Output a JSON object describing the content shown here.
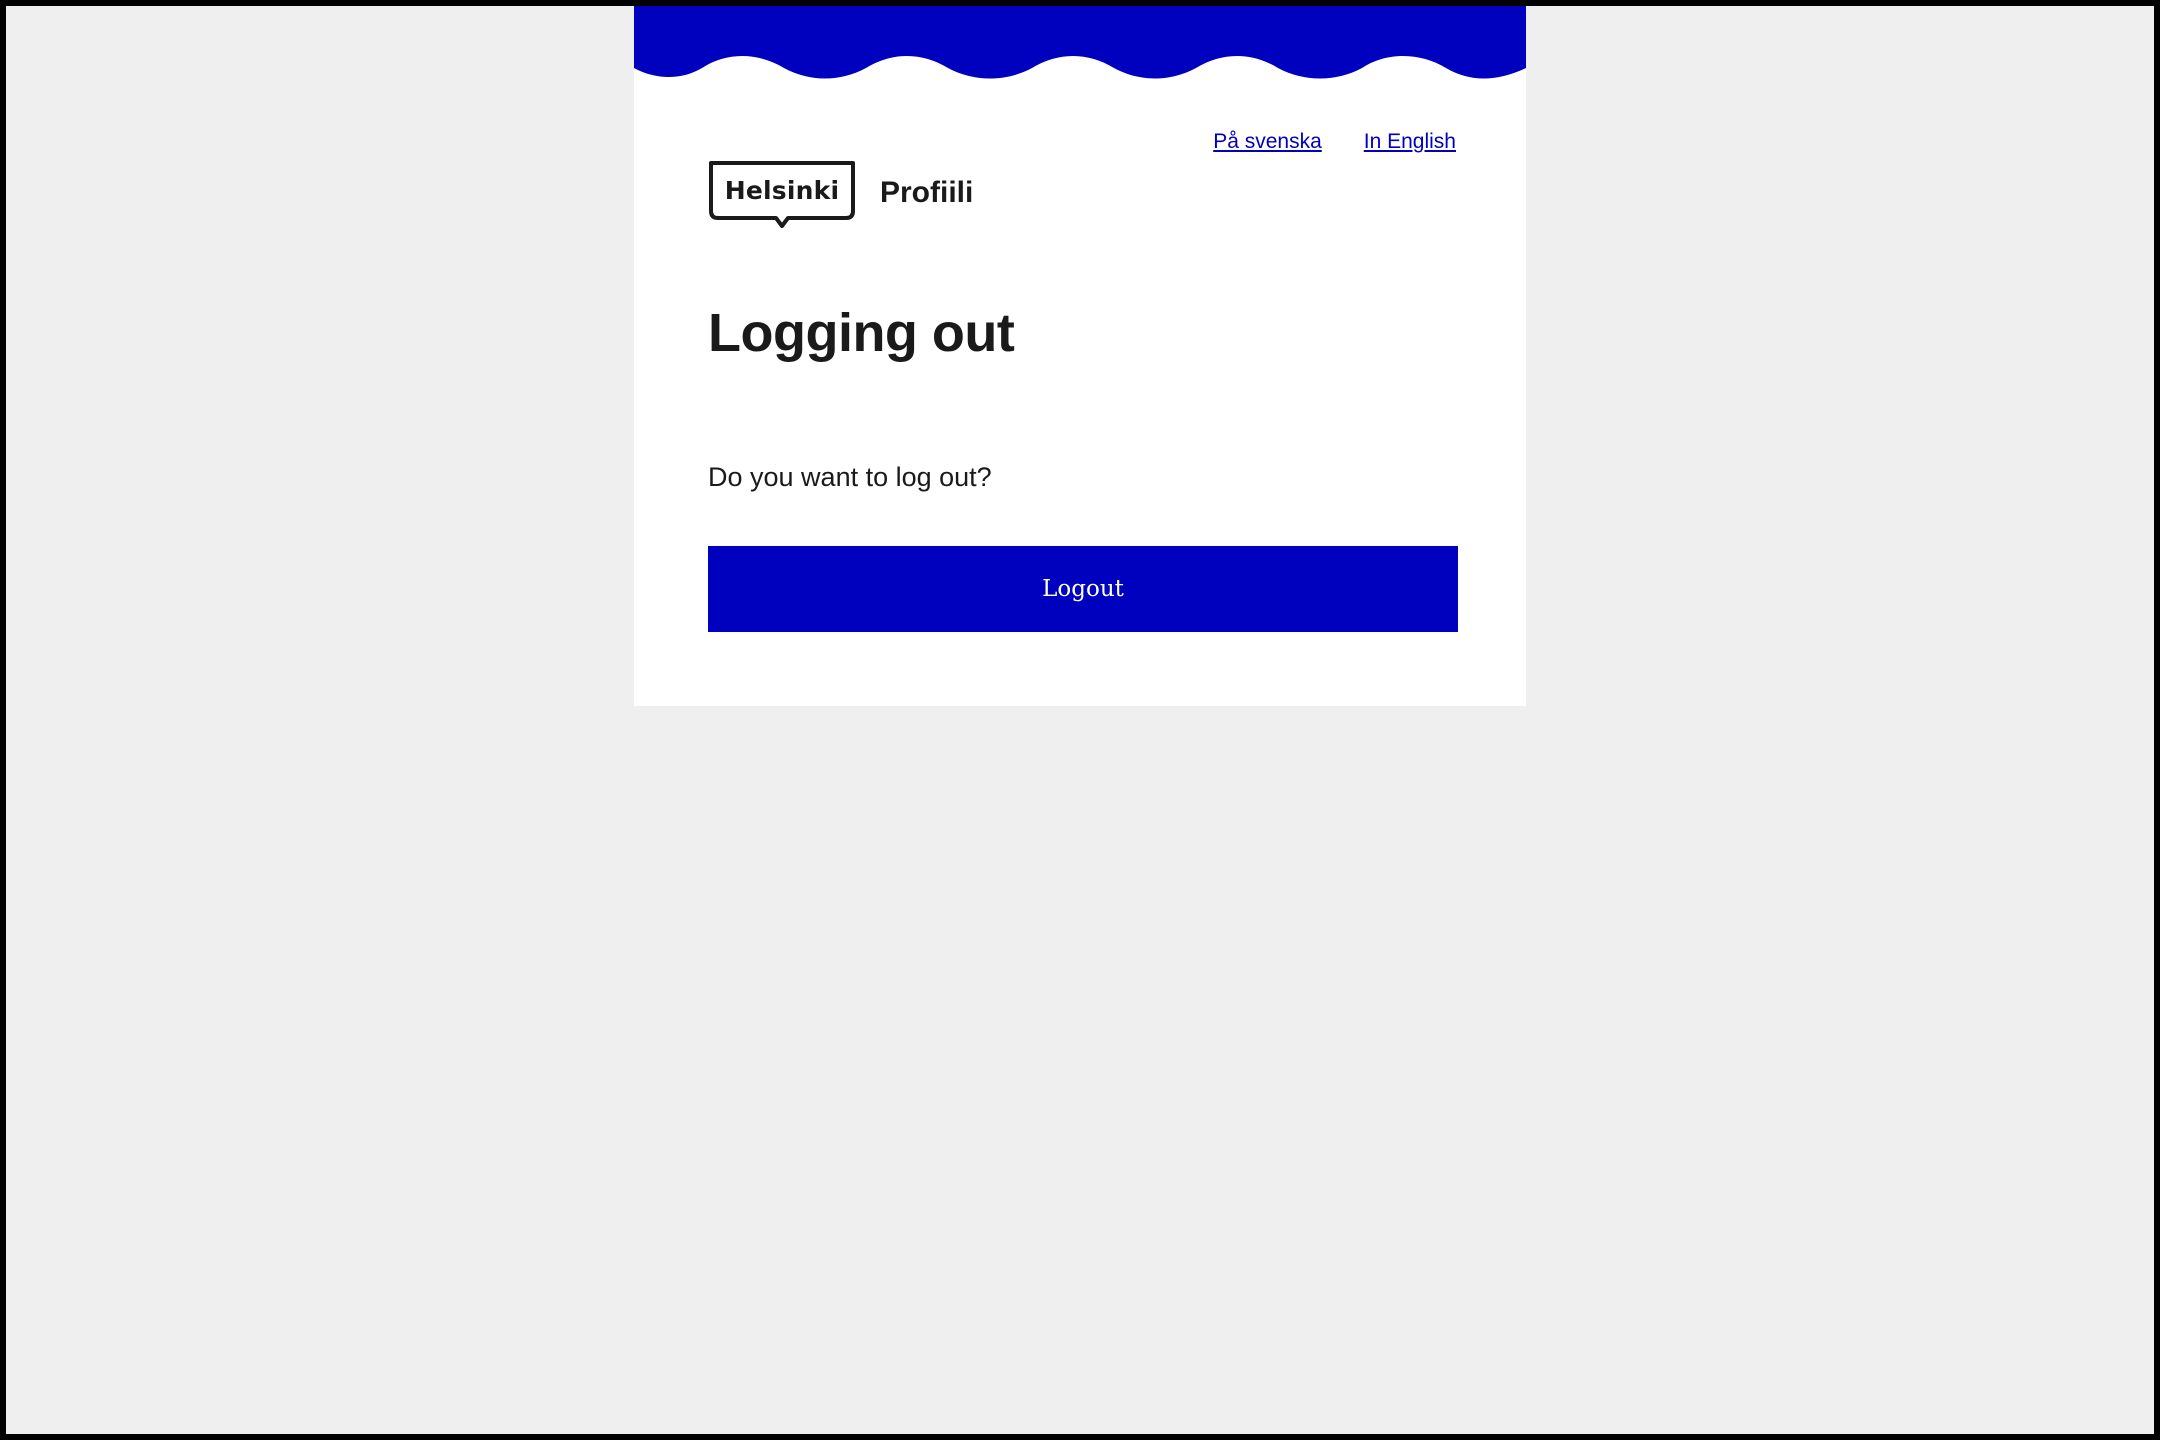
{
  "colors": {
    "brand_blue": "#0000bf",
    "page_background": "#efefef",
    "card_background": "#ffffff",
    "text": "#1a1a1a"
  },
  "header": {
    "languages": [
      {
        "label": "På svenska"
      },
      {
        "label": "In English"
      }
    ],
    "logo_text": "Helsinki",
    "app_name": "Profiili"
  },
  "main": {
    "title": "Logging out",
    "question": "Do you want to log out?",
    "logout_label": "Logout"
  }
}
